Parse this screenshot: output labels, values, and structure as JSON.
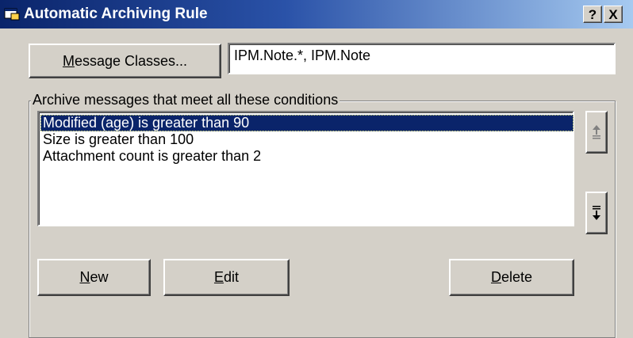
{
  "window": {
    "title": "Automatic Archiving Rule",
    "help_label": "?",
    "close_label": "X"
  },
  "message_classes": {
    "button_label_accel": "M",
    "button_label_rest": "essage Classes...",
    "value": "IPM.Note.*, IPM.Note"
  },
  "conditions": {
    "group_label": "Archive messages that meet all these conditions",
    "items": [
      "Modified (age) is greater than 90",
      "Size is greater than 100",
      "Attachment count is greater than 2"
    ],
    "selected_index": 0
  },
  "buttons": {
    "new_accel": "N",
    "new_rest": "ew",
    "edit_accel": "E",
    "edit_rest": "dit",
    "delete_accel": "D",
    "delete_rest": "elete"
  },
  "icons": {
    "app": "outlook-window-icon",
    "move_up": "move-up-icon",
    "move_down": "move-down-icon"
  },
  "colors": {
    "titlebar_start": "#0a246a",
    "titlebar_end": "#a6caf0",
    "selection": "#0a246a",
    "dialog_bg": "#d4d0c8"
  }
}
